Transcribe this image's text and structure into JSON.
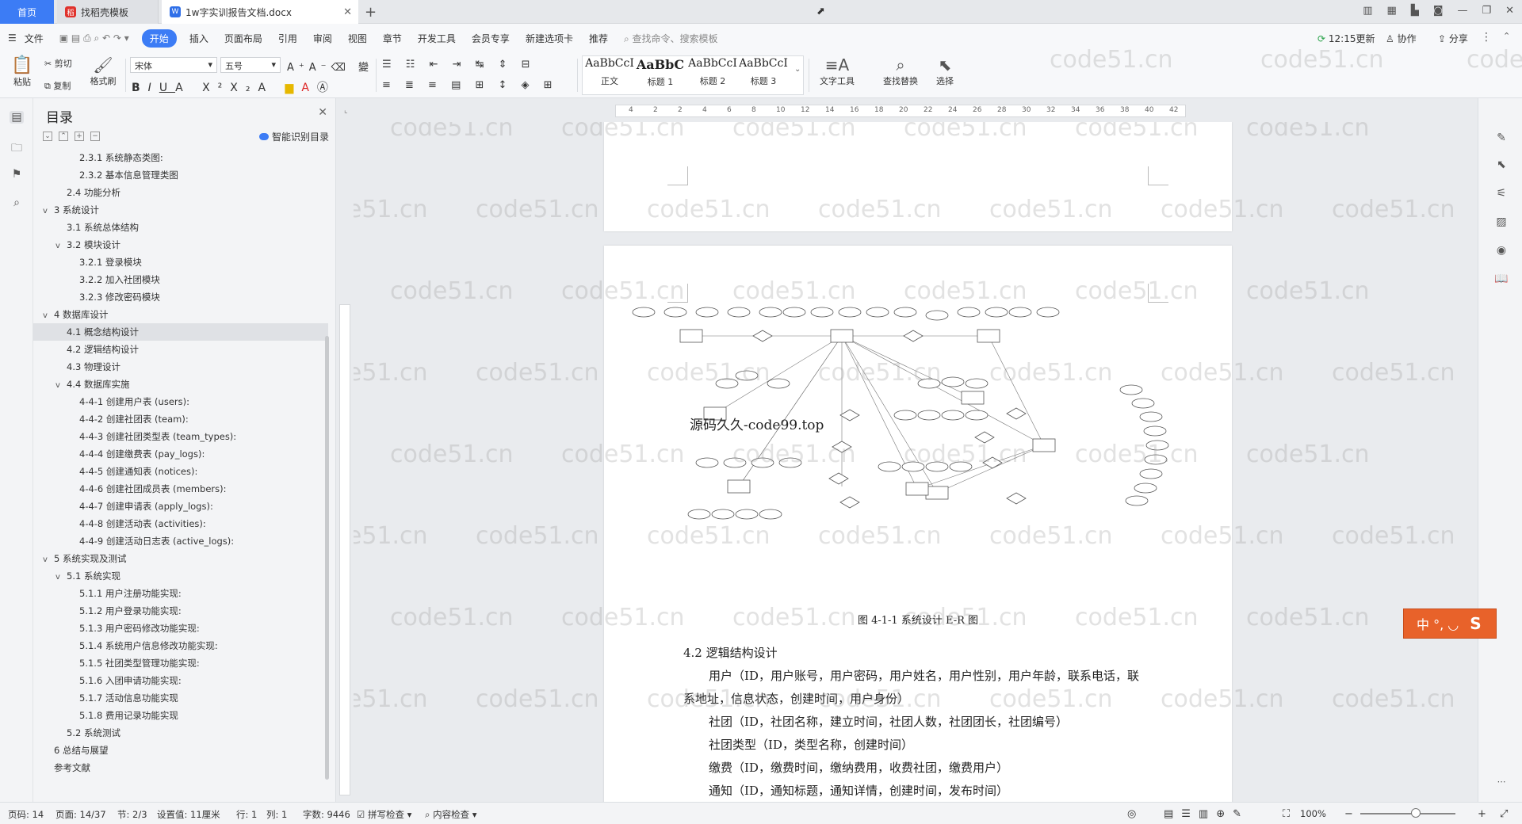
{
  "tabs": {
    "home": "首页",
    "template": "找稻壳模板",
    "document": "1w字实训报告文档.docx",
    "new_tab": "+"
  },
  "menu": [
    "文件",
    "开始",
    "插入",
    "页面布局",
    "引用",
    "审阅",
    "视图",
    "章节",
    "开发工具",
    "会员专享",
    "新建选项卡",
    "推荐"
  ],
  "search_placeholder": "查找命令、搜索模板",
  "toolbar_right": {
    "sync": "12:15更新",
    "collab": "协作",
    "share": "分享"
  },
  "ribbon": {
    "paste": "粘贴",
    "cut": "剪切",
    "copy": "复制",
    "format_painter": "格式刷",
    "font_name": "宋体",
    "font_size": "五号",
    "styles": [
      {
        "preview": "AaBbCcI",
        "label": "正文"
      },
      {
        "preview": "AaBbC",
        "label": "标题 1"
      },
      {
        "preview": "AaBbCcI",
        "label": "标题 2"
      },
      {
        "preview": "AaBbCcI",
        "label": "标题 3"
      }
    ],
    "text_tools": "文字工具",
    "find_replace": "查找替换",
    "select": "选择"
  },
  "toc": {
    "title": "目录",
    "smart": "智能识别目录",
    "items": [
      {
        "level": 3,
        "text": "2.3.1 系统静态类图:",
        "caret": ""
      },
      {
        "level": 3,
        "text": "2.3.2 基本信息管理类图",
        "caret": ""
      },
      {
        "level": 2,
        "text": "2.4 功能分析",
        "caret": ""
      },
      {
        "level": 1,
        "text": "3 系统设计",
        "caret": "v"
      },
      {
        "level": 2,
        "text": "3.1 系统总体结构",
        "caret": ""
      },
      {
        "level": 2,
        "text": "3.2 模块设计",
        "caret": "v"
      },
      {
        "level": 3,
        "text": "3.2.1 登录模块",
        "caret": ""
      },
      {
        "level": 3,
        "text": "3.2.2 加入社团模块",
        "caret": ""
      },
      {
        "level": 3,
        "text": "3.2.3 修改密码模块",
        "caret": ""
      },
      {
        "level": 1,
        "text": "4 数据库设计",
        "caret": "v"
      },
      {
        "level": 2,
        "text": "4.1 概念结构设计",
        "caret": "",
        "selected": true
      },
      {
        "level": 2,
        "text": "4.2 逻辑结构设计",
        "caret": ""
      },
      {
        "level": 2,
        "text": "4.3 物理设计",
        "caret": ""
      },
      {
        "level": 2,
        "text": "4.4 数据库实施",
        "caret": "v"
      },
      {
        "level": 3,
        "text": "4-4-1 创建用户表 (users):",
        "caret": ""
      },
      {
        "level": 3,
        "text": "4-4-2 创建社团表 (team):",
        "caret": ""
      },
      {
        "level": 3,
        "text": "4-4-3 创建社团类型表 (team_types):",
        "caret": ""
      },
      {
        "level": 3,
        "text": "4-4-4 创建缴费表 (pay_logs):",
        "caret": ""
      },
      {
        "level": 3,
        "text": "4-4-5 创建通知表 (notices):",
        "caret": ""
      },
      {
        "level": 3,
        "text": "4-4-6 创建社团成员表 (members):",
        "caret": ""
      },
      {
        "level": 3,
        "text": "4-4-7 创建申请表 (apply_logs):",
        "caret": ""
      },
      {
        "level": 3,
        "text": "4-4-8 创建活动表 (activities):",
        "caret": ""
      },
      {
        "level": 3,
        "text": "4-4-9 创建活动日志表 (active_logs):",
        "caret": ""
      },
      {
        "level": 1,
        "text": "5 系统实现及测试",
        "caret": "v"
      },
      {
        "level": 2,
        "text": "5.1 系统实现",
        "caret": "v"
      },
      {
        "level": 3,
        "text": "5.1.1 用户注册功能实现:",
        "caret": ""
      },
      {
        "level": 3,
        "text": "5.1.2 用户登录功能实现:",
        "caret": ""
      },
      {
        "level": 3,
        "text": "5.1.3 用户密码修改功能实现:",
        "caret": ""
      },
      {
        "level": 3,
        "text": "5.1.4 系统用户信息修改功能实现:",
        "caret": ""
      },
      {
        "level": 3,
        "text": "5.1.5 社团类型管理功能实现:",
        "caret": ""
      },
      {
        "level": 3,
        "text": "5.1.6 入团申请功能实现:",
        "caret": ""
      },
      {
        "level": 3,
        "text": "5.1.7 活动信息功能实现",
        "caret": ""
      },
      {
        "level": 3,
        "text": "5.1.8 费用记录功能实现",
        "caret": ""
      },
      {
        "level": 2,
        "text": "5.2 系统测试",
        "caret": ""
      },
      {
        "level": 1,
        "text": "6 总结与展望",
        "caret": ""
      },
      {
        "level": 1,
        "text": "参考文献",
        "caret": ""
      }
    ]
  },
  "ruler": {
    "marks": [
      "4",
      "2",
      "2",
      "4",
      "6",
      "8",
      "10",
      "12",
      "14",
      "16",
      "18",
      "20",
      "22",
      "24",
      "26",
      "28",
      "30",
      "32",
      "34",
      "36",
      "38",
      "40",
      "42"
    ]
  },
  "document": {
    "overlay": "源码久久-code99.top",
    "caption": "图 4-1-1 系统设计 E-R 图",
    "heading": "4.2 逻辑结构设计",
    "para1a": "用户（ID，用户账号，用户密码，用户姓名，用户性别，用户年龄，联系电话，联",
    "para1b": "系地址，信息状态，创建时间，用户身份）",
    "para2": "社团（ID，社团名称，建立时间，社团人数，社团团长，社团编号）",
    "para3": "社团类型（ID，类型名称，创建时间）",
    "para4": "缴费（ID，缴费时间，缴纳费用，收费社团，缴费用户）",
    "para5": "通知（ID，通知标题，通知详情，创建时间，发布时间）"
  },
  "watermark": "code51.cn",
  "ime": "中 °, ◡",
  "statusbar": {
    "page_num": "页码: 14",
    "page": "页面: 14/37",
    "section": "节: 2/3",
    "setting": "设置值: 11厘米",
    "row": "行: 1",
    "col": "列: 1",
    "words": "字数: 9446",
    "spell": "拼写检查",
    "content": "内容检查",
    "zoom": "100%"
  }
}
